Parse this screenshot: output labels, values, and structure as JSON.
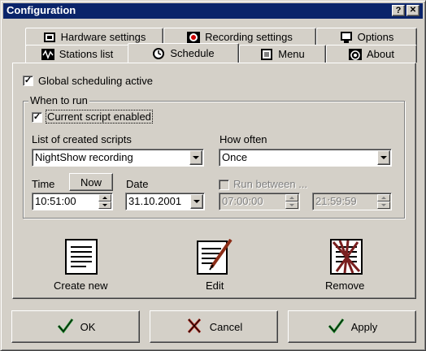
{
  "window": {
    "title": "Configuration",
    "help_button": "?",
    "close_button": "✕"
  },
  "tabs": {
    "row_back": [
      {
        "label": "Hardware settings",
        "mnemonic_index": 0,
        "icon": "hardware-icon"
      },
      {
        "label": "Recording settings",
        "mnemonic_index": 0,
        "icon": "record-icon"
      },
      {
        "label": "Options",
        "mnemonic_index": 0,
        "icon": "monitor-icon"
      }
    ],
    "row_front": [
      {
        "label": "Stations list",
        "mnemonic_index": 0,
        "icon": "waveform-icon"
      },
      {
        "label": "Schedule",
        "mnemonic_index": 0,
        "icon": "clock-icon",
        "active": true
      },
      {
        "label": "Menu",
        "mnemonic_index": 0,
        "icon": "menu-icon"
      },
      {
        "label": "About",
        "mnemonic_index": 0,
        "icon": "about-icon"
      }
    ]
  },
  "schedule": {
    "global_active": {
      "label": "Global scheduling active",
      "checked": true
    },
    "when_to_run": {
      "group_label": "When to run",
      "current_enabled": {
        "label": "Current script enabled",
        "checked": true
      },
      "scripts_label": "List of created scripts",
      "scripts_value": "NightShow recording",
      "how_often_label": "How often",
      "how_often_value": "Once",
      "time_label": "Time",
      "now_button": "Now",
      "time_value": "10:51:00",
      "date_label": "Date",
      "date_value": "31.10.2001",
      "run_between": {
        "label": "Run between ...",
        "checked": false,
        "enabled": false
      },
      "from_value": "07:00:00",
      "to_value": "21:59:59"
    },
    "actions": [
      {
        "label": "Create new",
        "icon": "create-new-icon"
      },
      {
        "label": "Edit",
        "icon": "edit-icon"
      },
      {
        "label": "Remove",
        "icon": "remove-icon"
      }
    ]
  },
  "footer": {
    "ok": "OK",
    "cancel": "Cancel",
    "apply": "Apply"
  },
  "colors": {
    "titlebar": "#0a246a",
    "face": "#d4d0c8",
    "check_green": "#1a8c2a",
    "cancel_red": "#b0281e"
  }
}
